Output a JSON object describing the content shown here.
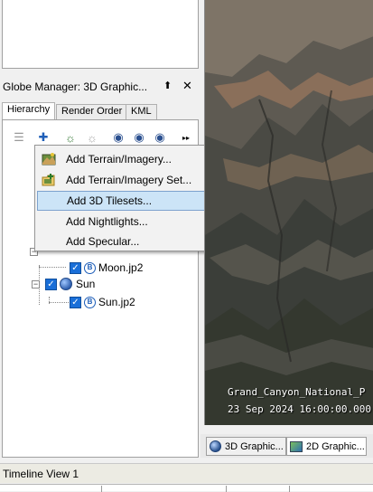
{
  "globe_manager": {
    "title": "Globe Manager: 3D Graphic...",
    "pin_glyph": "⬆",
    "close_glyph": "✕",
    "tabs": [
      {
        "label": "Hierarchy",
        "active": true
      },
      {
        "label": "Render Order",
        "active": false
      },
      {
        "label": "KML",
        "active": false
      }
    ],
    "toolbar": [
      {
        "icon": "properties-icon",
        "glyph": "☰"
      },
      {
        "icon": "add-icon",
        "glyph": "✚"
      },
      {
        "icon": "add-globe-icon",
        "glyph": "☼"
      },
      {
        "icon": "remove-globe-icon",
        "glyph": "☼"
      },
      {
        "icon": "globe-settings-icon",
        "glyph": "◉"
      },
      {
        "icon": "globe-save-icon",
        "glyph": "◉"
      },
      {
        "icon": "globe-add-icon",
        "glyph": "◉"
      },
      {
        "icon": "more-icon",
        "glyph": "▸▸"
      }
    ],
    "tree": {
      "moon_file": "Moon.jp2",
      "sun_node": "Sun",
      "sun_file": "Sun.jp2"
    }
  },
  "context_menu": {
    "items": [
      {
        "label": "Add Terrain/Imagery...",
        "icon": "terrain-imagery-icon",
        "highlighted": false
      },
      {
        "label": "Add Terrain/Imagery Set...",
        "icon": "imagery-set-folder-icon",
        "highlighted": false
      },
      {
        "label": "Add 3D Tilesets...",
        "icon": "",
        "highlighted": true
      },
      {
        "label": "Add Nightlights...",
        "icon": "",
        "highlighted": false
      },
      {
        "label": "Add Specular...",
        "icon": "",
        "highlighted": false
      }
    ]
  },
  "map_view": {
    "location_caption": "Grand_Canyon_National_P",
    "date_caption": "23 Sep 2024 16:00:00.000"
  },
  "view_tabs": [
    {
      "label": "3D Graphic...",
      "icon": "globe-view-icon",
      "active": false
    },
    {
      "label": "2D Graphic...",
      "icon": "map-view-icon",
      "active": true
    }
  ],
  "timeline": {
    "title": "Timeline View 1"
  }
}
